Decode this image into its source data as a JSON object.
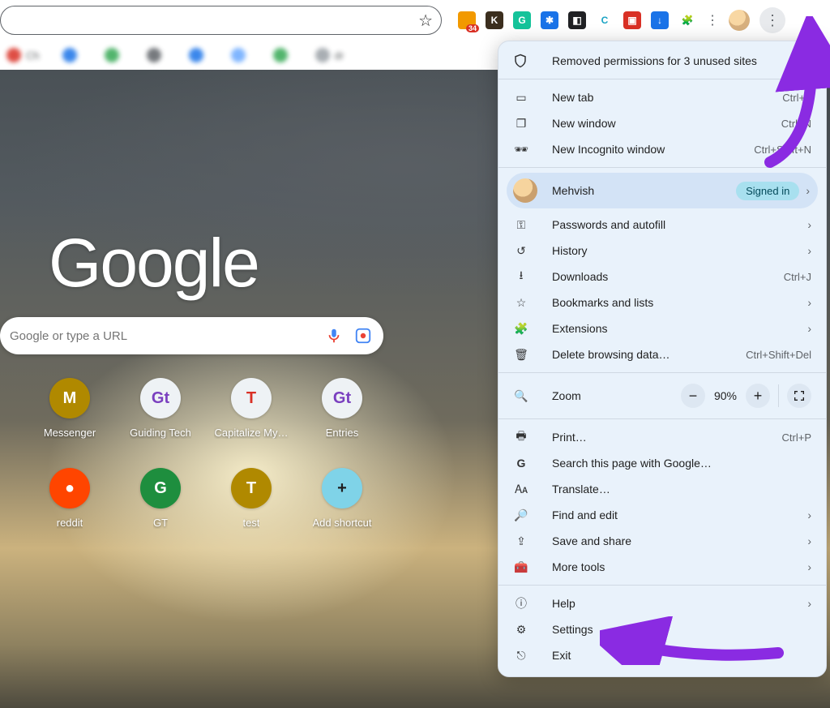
{
  "toolbar": {
    "extensions": [
      {
        "name": "ext-orange",
        "bg": "#f29900",
        "txt": "",
        "badge": "34"
      },
      {
        "name": "ext-k",
        "bg": "#3b2e1e",
        "txt": "K",
        "badge": ""
      },
      {
        "name": "ext-grammarly",
        "bg": "#15c39a",
        "txt": "G",
        "badge": ""
      },
      {
        "name": "ext-blue1",
        "bg": "#1a73e8",
        "txt": "✱",
        "badge": ""
      },
      {
        "name": "ext-box",
        "bg": "#202124",
        "txt": "◧",
        "badge": ""
      },
      {
        "name": "ext-teal",
        "bg": "#ffffff",
        "txt": "C",
        "badge": "",
        "fg": "#1aa3c4"
      },
      {
        "name": "ext-red",
        "bg": "#d93025",
        "txt": "▣",
        "badge": ""
      },
      {
        "name": "ext-dl",
        "bg": "#1a73e8",
        "txt": "↓",
        "badge": ""
      }
    ],
    "puzzle_icon": "🧩"
  },
  "bookmarks": [
    {
      "label": "Ch",
      "bg": "#d93025"
    },
    {
      "label": "",
      "bg": "#1a73e8"
    },
    {
      "label": "",
      "bg": "#34a853"
    },
    {
      "label": "",
      "bg": "#5f6368"
    },
    {
      "label": "",
      "bg": "#1a73e8"
    },
    {
      "label": "",
      "bg": "#6aa9ff"
    },
    {
      "label": "",
      "bg": "#34a853"
    },
    {
      "label": "dr",
      "bg": "#9aa0a6"
    }
  ],
  "ntp": {
    "logo": "Google",
    "search_placeholder": "Google or type a URL",
    "shortcuts": [
      {
        "label": "Messenger",
        "letter": "M",
        "bg": "#b08900",
        "fg": "#fff"
      },
      {
        "label": "Guiding Tech",
        "letter": "Gt",
        "bg": "#eef2f5",
        "fg": "#7a3fbf"
      },
      {
        "label": "Capitalize My…",
        "letter": "T",
        "bg": "#eef2f5",
        "fg": "#d93025"
      },
      {
        "label": "Entries",
        "letter": "Gt",
        "bg": "#eef2f5",
        "fg": "#7a3fbf"
      },
      {
        "label": "reddit",
        "letter": "●",
        "bg": "#ff4500",
        "fg": "#fff"
      },
      {
        "label": "GT",
        "letter": "G",
        "bg": "#1e8e3e",
        "fg": "#fff"
      },
      {
        "label": "test",
        "letter": "T",
        "bg": "#b08900",
        "fg": "#fff"
      },
      {
        "label": "Add shortcut",
        "letter": "+",
        "bg": "#7fd3e8",
        "fg": "#1f1f1f"
      }
    ]
  },
  "menu": {
    "removed": "Removed permissions for 3 unused sites",
    "new_tab": {
      "label": "New tab",
      "shortcut": "Ctrl+T"
    },
    "new_window": {
      "label": "New window",
      "shortcut": "Ctrl+N"
    },
    "incognito": {
      "label": "New Incognito window",
      "shortcut": "Ctrl+Shift+N"
    },
    "profile": {
      "name": "Mehvish",
      "status": "Signed in"
    },
    "passwords": {
      "label": "Passwords and autofill"
    },
    "history": {
      "label": "History"
    },
    "downloads": {
      "label": "Downloads",
      "shortcut": "Ctrl+J"
    },
    "bookmarks": {
      "label": "Bookmarks and lists"
    },
    "extensions": {
      "label": "Extensions"
    },
    "delete_data": {
      "label": "Delete browsing data…",
      "shortcut": "Ctrl+Shift+Del"
    },
    "zoom": {
      "label": "Zoom",
      "value": "90%"
    },
    "print": {
      "label": "Print…",
      "shortcut": "Ctrl+P"
    },
    "search_page": {
      "label": "Search this page with Google…"
    },
    "translate": {
      "label": "Translate…"
    },
    "find": {
      "label": "Find and edit"
    },
    "save_share": {
      "label": "Save and share"
    },
    "more_tools": {
      "label": "More tools"
    },
    "help": {
      "label": "Help"
    },
    "settings": {
      "label": "Settings"
    },
    "exit": {
      "label": "Exit"
    }
  }
}
